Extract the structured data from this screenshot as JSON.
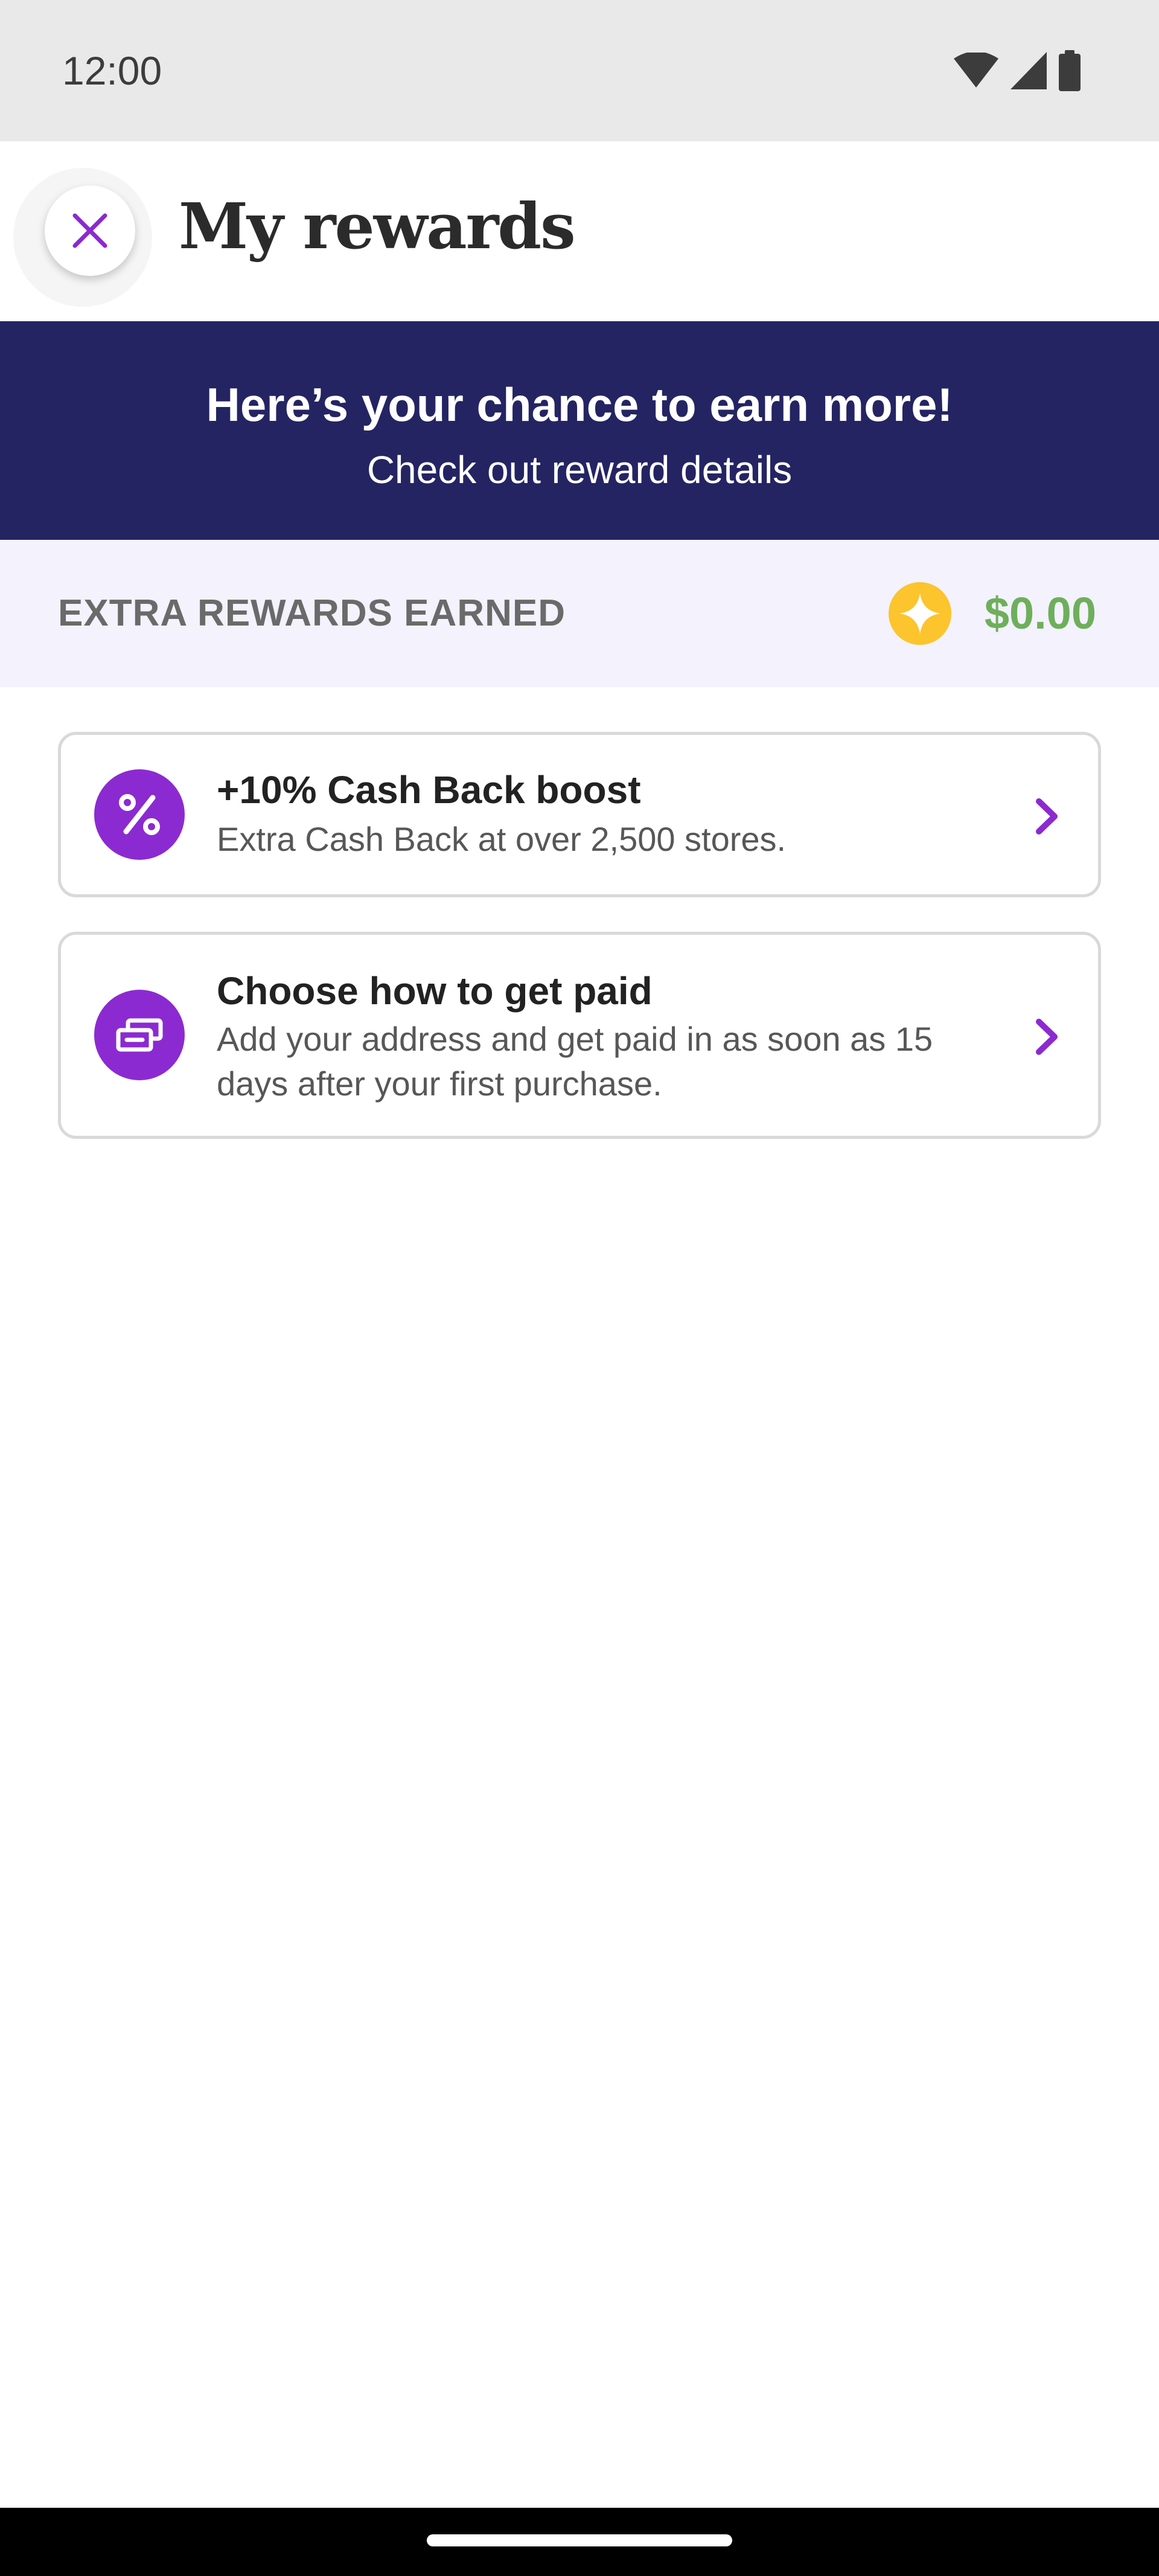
{
  "status_bar": {
    "time": "12:00",
    "icons": [
      "wifi-icon",
      "cellular-signal-icon",
      "battery-icon"
    ]
  },
  "header": {
    "title": "My rewards",
    "close_icon": "close-icon"
  },
  "promo": {
    "title": "Here’s your chance to earn more!",
    "link": "Check out reward details"
  },
  "earned": {
    "label": "EXTRA REWARDS EARNED",
    "amount": "$0.00",
    "icon": "star-coin-icon"
  },
  "cards": [
    {
      "title": "+10% Cash Back boost",
      "description": "Extra Cash Back at over 2,500 stores.",
      "icon": "percent-icon"
    },
    {
      "title": "Choose how to get paid",
      "description": "Add your address and get paid in as soon as 15 days after your first purchase.",
      "icon": "payment-cards-icon"
    }
  ],
  "colors": {
    "accent_purple": "#8b2ad1",
    "banner_navy": "#242463",
    "earned_bg": "#f3f2fd",
    "money_green": "#6eaf5b",
    "coin_yellow": "#fcc42d"
  }
}
